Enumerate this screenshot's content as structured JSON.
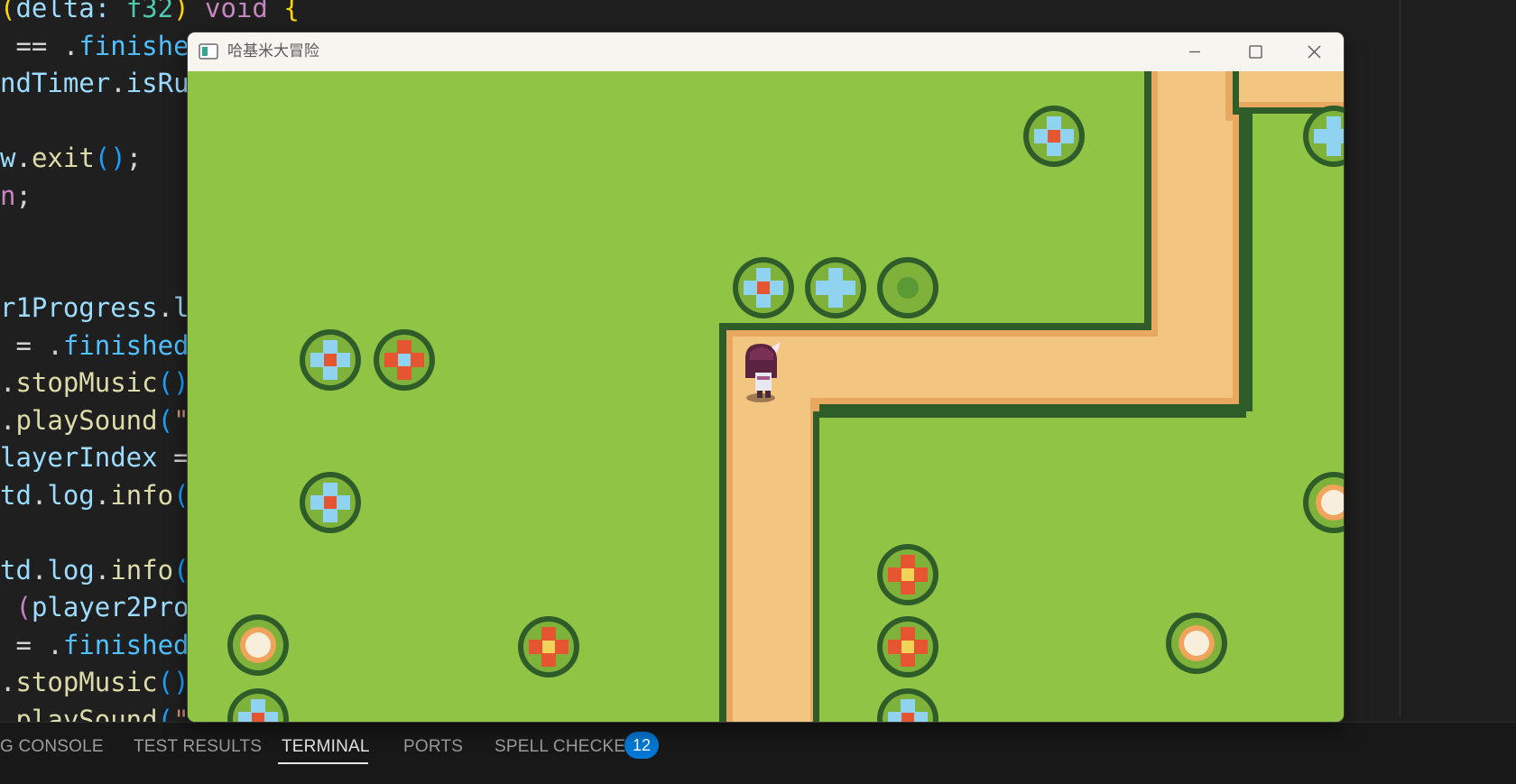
{
  "editor": {
    "lines": [
      [
        {
          "c": "t-yel",
          "t": "("
        },
        {
          "c": "t-var",
          "t": "delta: "
        },
        {
          "c": "t-typ",
          "t": "f32"
        },
        {
          "c": "t-yel",
          "t": ") "
        },
        {
          "c": "t-kw",
          "t": "void"
        },
        {
          "c": "t-plain",
          "t": " "
        },
        {
          "c": "t-yel",
          "t": "{"
        }
      ],
      [
        {
          "c": "t-plain",
          "t": " == ."
        },
        {
          "c": "t-enum",
          "t": "finished"
        },
        {
          "c": "t-kw",
          "t": ") {"
        }
      ],
      [
        {
          "c": "t-var",
          "t": "ndTimer"
        },
        {
          "c": "t-plain",
          "t": "."
        },
        {
          "c": "t-var",
          "t": "isRu"
        }
      ],
      [],
      [
        {
          "c": "t-var",
          "t": "w"
        },
        {
          "c": "t-plain",
          "t": "."
        },
        {
          "c": "t-fn",
          "t": "exit"
        },
        {
          "c": "t-brk",
          "t": "()"
        },
        {
          "c": "t-plain",
          "t": ";"
        }
      ],
      [
        {
          "c": "t-kw",
          "t": "n"
        },
        {
          "c": "t-plain",
          "t": ";"
        }
      ],
      [],
      [],
      [
        {
          "c": "t-var",
          "t": "r1Progress"
        },
        {
          "c": "t-plain",
          "t": "."
        },
        {
          "c": "t-var",
          "t": "l"
        }
      ],
      [
        {
          "c": "t-plain",
          "t": " = ."
        },
        {
          "c": "t-enum",
          "t": "finished"
        }
      ],
      [
        {
          "c": "t-plain",
          "t": "."
        },
        {
          "c": "t-fn",
          "t": "stopMusic"
        },
        {
          "c": "t-brk",
          "t": "()"
        }
      ],
      [
        {
          "c": "t-plain",
          "t": "."
        },
        {
          "c": "t-fn",
          "t": "playSound"
        },
        {
          "c": "t-brk",
          "t": "("
        },
        {
          "c": "t-str",
          "t": "\""
        }
      ],
      [
        {
          "c": "t-var",
          "t": "layerIndex"
        },
        {
          "c": "t-plain",
          "t": " ="
        }
      ],
      [
        {
          "c": "t-var",
          "t": "td"
        },
        {
          "c": "t-plain",
          "t": "."
        },
        {
          "c": "t-var",
          "t": "log"
        },
        {
          "c": "t-plain",
          "t": "."
        },
        {
          "c": "t-fn",
          "t": "info"
        },
        {
          "c": "t-brk",
          "t": "("
        }
      ],
      [],
      [
        {
          "c": "t-var",
          "t": "td"
        },
        {
          "c": "t-plain",
          "t": "."
        },
        {
          "c": "t-var",
          "t": "log"
        },
        {
          "c": "t-plain",
          "t": "."
        },
        {
          "c": "t-fn",
          "t": "info"
        },
        {
          "c": "t-brk",
          "t": "("
        }
      ],
      [
        {
          "c": "t-plain",
          "t": " "
        },
        {
          "c": "t-kw",
          "t": "("
        },
        {
          "c": "t-var",
          "t": "player2Pro"
        }
      ],
      [
        {
          "c": "t-plain",
          "t": " = ."
        },
        {
          "c": "t-enum",
          "t": "finished"
        }
      ],
      [
        {
          "c": "t-plain",
          "t": "."
        },
        {
          "c": "t-fn",
          "t": "stopMusic"
        },
        {
          "c": "t-brk",
          "t": "()"
        }
      ],
      [
        {
          "c": "t-plain",
          "t": "."
        },
        {
          "c": "t-fn",
          "t": "playSound"
        },
        {
          "c": "t-brk",
          "t": "("
        },
        {
          "c": "t-str",
          "t": "\""
        }
      ]
    ]
  },
  "game_window": {
    "title": "哈基米大冒险",
    "minimize_icon": "minimize-icon",
    "maximize_icon": "maximize-icon",
    "close_icon": "close-icon"
  },
  "panel": {
    "tabs": [
      {
        "label": "G CONSOLE",
        "active": false
      },
      {
        "label": "TEST RESULTS",
        "active": false
      },
      {
        "label": "TERMINAL",
        "active": true
      },
      {
        "label": "PORTS",
        "active": false
      },
      {
        "label": "SPELL CHECKER",
        "active": false
      }
    ],
    "spell_checker_count": "12"
  },
  "colors": {
    "grass": "#8fc445",
    "path": "#f2c680",
    "path_edge": "#e9a860",
    "hedge": "#2f5d2a",
    "accent": "#0078d4"
  }
}
